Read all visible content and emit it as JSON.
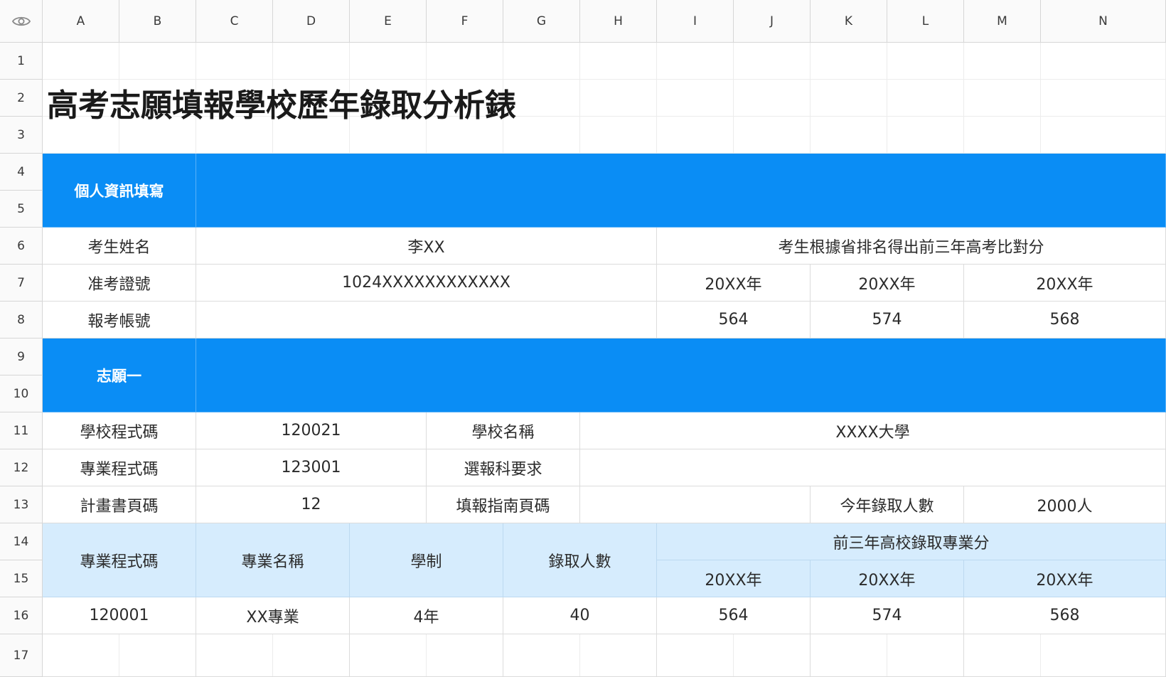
{
  "columns": [
    "A",
    "B",
    "C",
    "D",
    "E",
    "F",
    "G",
    "H",
    "I",
    "J",
    "K",
    "L",
    "M",
    "N"
  ],
  "rows": [
    "1",
    "2",
    "3",
    "4",
    "5",
    "6",
    "7",
    "8",
    "9",
    "10",
    "11",
    "12",
    "13",
    "14",
    "15",
    "16",
    "17"
  ],
  "title": "高考志願填報學校歷年錄取分析錶",
  "section_personal": {
    "header": "個人資訊填寫",
    "name_label": "考生姓名",
    "name_value": "李XX",
    "exam_id_label": "准考證號",
    "exam_id_value": "1024XXXXXXXXXXXX",
    "account_label": "報考帳號",
    "account_value": "",
    "compare_header": "考生根據省排名得出前三年高考比對分",
    "years": [
      "20XX年",
      "20XX年",
      "20XX年"
    ],
    "scores": [
      "564",
      "574",
      "568"
    ]
  },
  "section_choice1": {
    "header": "志願一",
    "school_code_label": "學校程式碼",
    "school_code_value": "120021",
    "school_name_label": "學校名稱",
    "school_name_value": "XXXX大學",
    "major_code_label": "專業程式碼",
    "major_code_value": "123001",
    "subject_req_label": "選報科要求",
    "subject_req_value": "",
    "plan_page_label": "計畫書頁碼",
    "plan_page_value": "12",
    "guide_page_label": "填報指南頁碼",
    "guide_page_value": "",
    "admit_count_label": "今年錄取人數",
    "admit_count_value": "2000人"
  },
  "table": {
    "headers": {
      "major_code": "專業程式碼",
      "major_name": "專業名稱",
      "system": "學制",
      "admit_count": "錄取人數",
      "prev_scores": "前三年高校錄取專業分",
      "years": [
        "20XX年",
        "20XX年",
        "20XX年"
      ]
    },
    "rows": [
      {
        "major_code": "120001",
        "major_name": "XX專業",
        "system": "4年",
        "admit_count": "40",
        "scores": [
          "564",
          "574",
          "568"
        ]
      }
    ]
  },
  "icons": {
    "corner": "eye-icon"
  },
  "colors": {
    "band": "#0a8df5",
    "light_band": "#d6ecfd"
  }
}
